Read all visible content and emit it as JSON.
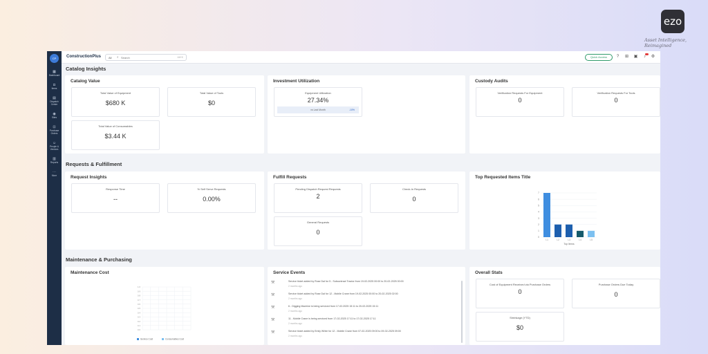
{
  "logo_text": "ezo",
  "tagline": "Asset Intelligence, Reimagined",
  "app": {
    "sidebar": [
      {
        "label": "Dashboard",
        "icon": "grid-icon"
      },
      {
        "label": "Items",
        "icon": "box-icon"
      },
      {
        "label": "Dispatch Center",
        "icon": "dispatch-icon"
      },
      {
        "label": "Sites",
        "icon": "location-icon"
      },
      {
        "label": "Purchase Orders",
        "icon": "cart-icon"
      },
      {
        "label": "People & Vendors",
        "icon": "people-icon"
      },
      {
        "label": "Reports",
        "icon": "reports-icon"
      },
      {
        "label": "More",
        "icon": "dots-icon"
      }
    ],
    "brand": "ConstructionPlus",
    "search": {
      "scope": "All",
      "placeholder": "Search",
      "shortcut": "Alt+K"
    },
    "quick_access": "Quick Access",
    "catalog": {
      "title": "Catalog Insights",
      "catalog_value": {
        "title": "Catalog Value",
        "items": [
          {
            "label": "Total Value of Equipment",
            "value": "$680 K"
          },
          {
            "label": "Total Value of Tools",
            "value": "$0"
          },
          {
            "label": "Total Value of Consumables",
            "value": "$3.44 K"
          }
        ]
      },
      "investment": {
        "title": "Investment Utilization",
        "label": "Equipment Utilization",
        "value": "27.34%",
        "bench_label": "vs Last Month",
        "bench_value": "-10%"
      },
      "custody": {
        "title": "Custody Audits",
        "items": [
          {
            "label": "Verification Requests For Equipment",
            "value": "0"
          },
          {
            "label": "Verification Requests For Tools",
            "value": "0"
          }
        ]
      }
    },
    "requests": {
      "title": "Requests & Fulfillment",
      "insights": {
        "title": "Request Insights",
        "items": [
          {
            "label": "Response Time",
            "value": "--"
          },
          {
            "label": "% Self Serve Requests",
            "value": "0.00%"
          }
        ]
      },
      "fulfill": {
        "title": "Fulfill Requests",
        "items": [
          {
            "label": "Pending Dispatch Request Requests",
            "value": "2"
          },
          {
            "label": "Check-In Requests",
            "value": "0"
          },
          {
            "label": "General Requests",
            "value": "0"
          }
        ]
      },
      "top_requested": {
        "title": "Top Requested Items Title",
        "xlabel": "Top Items"
      }
    },
    "maintenance": {
      "title": "Maintenance & Purchasing",
      "cost": {
        "title": "Maintenance Cost",
        "legend": [
          "Service Cost",
          "Consumables Cost"
        ]
      },
      "service_events": {
        "title": "Service Events",
        "events": [
          {
            "text": "Service ticket added by Rose Dal for 5 - Subcontract Tractor from 19-02-2025 00:00 to 20-02-2025 00:00",
            "time": "2 months ago"
          },
          {
            "text": "Service ticket added by Rose Dal for 12 - Mobile Crane from 19-02-2025 00:00 to 20-02-2025 02:00",
            "time": "2 months ago"
          },
          {
            "text": "6 - Digging Machine is being serviced from 17-02-2025 15:11 to 20-02-2025 15:11",
            "time": "2 months ago"
          },
          {
            "text": "11 - Mobile Crane is being serviced from 17-02-2025 17:11 to 17-02-2025 17:11",
            "time": "2 months ago"
          },
          {
            "text": "Service ticket added by Emily White for 12 - Mobile Crane from 07-02-2025 09:00 to 09-02-2025 09:00",
            "time": "2 months ago"
          }
        ]
      },
      "overall": {
        "title": "Overall Stats",
        "items": [
          {
            "label": "Cost of Equipment Received via Purchase Orders",
            "value": "0"
          },
          {
            "label": "Purchase Orders Due Today",
            "value": "0"
          },
          {
            "label": "Shrinkage (YTD)",
            "value": "$0"
          }
        ]
      }
    }
  },
  "chart_data": [
    {
      "type": "bar",
      "title": "Top Requested Items Title",
      "xlabel": "Top Items",
      "ylabel": "",
      "categories": [
        "I-1",
        "I-2",
        "I-3",
        "I-4",
        "I-5"
      ],
      "values": [
        7,
        2,
        2,
        1,
        1
      ],
      "ylim": [
        0,
        7
      ],
      "colors": [
        "#3f8ee0",
        "#1d5fae",
        "#1d5fae",
        "#155a6b",
        "#7cc0f0"
      ],
      "grid": true
    },
    {
      "type": "line",
      "title": "Maintenance Cost",
      "series": [
        {
          "name": "Service Cost",
          "values": []
        },
        {
          "name": "Consumables Cost",
          "values": []
        }
      ],
      "ylim": [
        0,
        1
      ],
      "grid": true,
      "legend": "bottom"
    }
  ]
}
